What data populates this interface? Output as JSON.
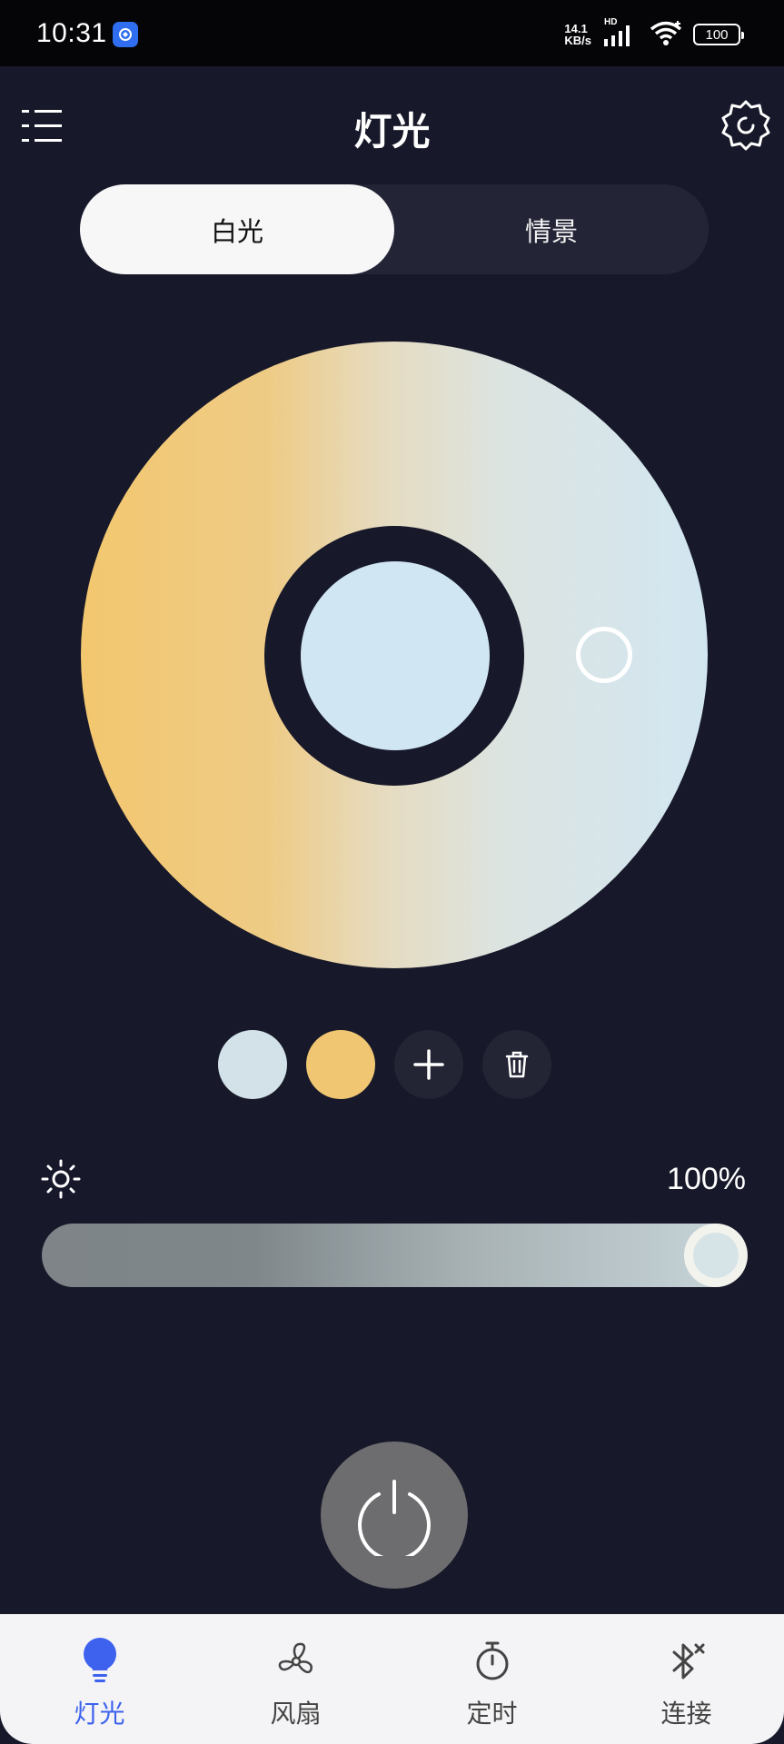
{
  "status_bar": {
    "time": "10:31",
    "net_speed_value": "14.1",
    "net_speed_unit": "KB/s",
    "network_badge": "HD",
    "battery": "100"
  },
  "header": {
    "title": "灯光"
  },
  "segment": {
    "tabs": [
      {
        "label": "白光",
        "active": true
      },
      {
        "label": "情景",
        "active": false
      }
    ]
  },
  "color_wheel": {
    "warm_color": "#f3c76f",
    "cool_color": "#d2e6f1",
    "selected_color": "#d0e6f3"
  },
  "presets": {
    "colors": [
      "#d2e2e8",
      "#f0c673"
    ],
    "add_icon": "plus-icon",
    "delete_icon": "trash-icon"
  },
  "brightness": {
    "value_label": "100%",
    "level": 1.0
  },
  "power": {
    "icon": "power-icon"
  },
  "bottom_nav": {
    "items": [
      {
        "label": "灯光",
        "icon": "bulb-icon",
        "active": true
      },
      {
        "label": "风扇",
        "icon": "fan-icon",
        "active": false
      },
      {
        "label": "定时",
        "icon": "stopwatch-icon",
        "active": false
      },
      {
        "label": "连接",
        "icon": "bluetooth-off-icon",
        "active": false
      }
    ]
  },
  "colors": {
    "background": "#171829",
    "accent": "#3e62ee"
  }
}
